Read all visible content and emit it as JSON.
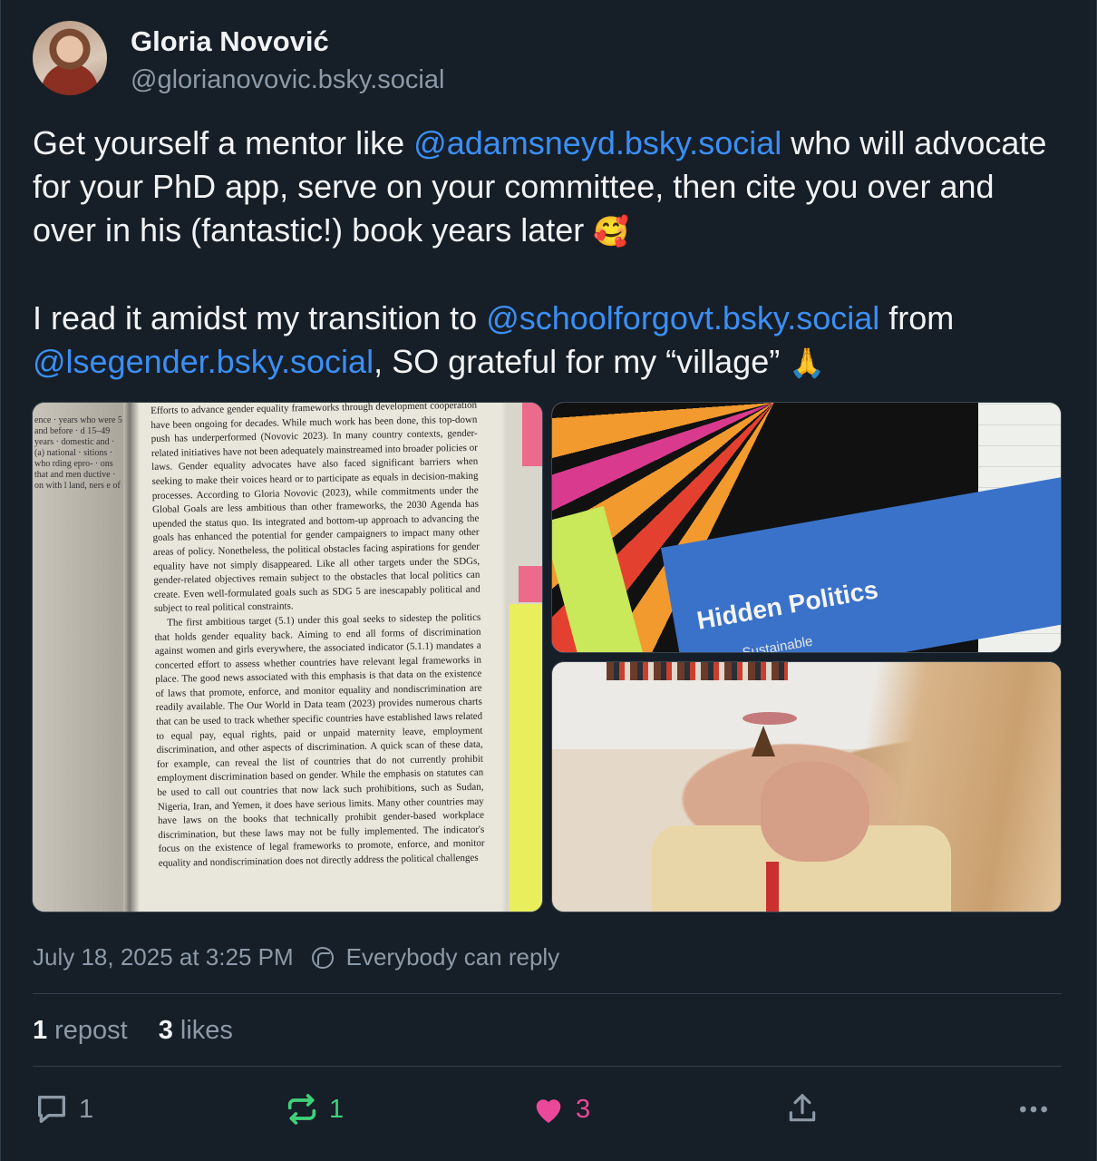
{
  "author": {
    "display_name": "Gloria Novović",
    "handle": "@glorianovovic.bsky.social"
  },
  "post": {
    "para1_a": "Get yourself a mentor like ",
    "mention1": "@adamsneyd.bsky.social",
    "para1_b": " who will advocate for your PhD app, serve on your committee, then cite you over and over in his (fantastic!) book years later ",
    "emoji1": "🥰",
    "para2_a": "I read it amidst my transition to ",
    "mention2": "@schoolforgovt.bsky.social",
    "para2_b": " from ",
    "mention3": "@lsegender.bsky.social",
    "para2_c": ", SO grateful for my “village” ",
    "emoji2": "🙏"
  },
  "media": {
    "book_page_para1": "Efforts to advance gender equality frameworks through development cooperation have been ongoing for decades. While much work has been done, this top-down push has underperformed (Novovic 2023). In many country contexts, gender-related initiatives have not been adequately mainstreamed into broader policies or laws. Gender equality advocates have also faced significant barriers when seeking to make their voices heard or to participate as equals in decision-making processes. According to Gloria Novovic (2023), while commitments under the Global Goals are less ambitious than other frameworks, the 2030 Agenda has upended the status quo. Its integrated and bottom-up approach to advancing the goals has enhanced the potential for gender campaigners to impact many other areas of policy. Nonetheless, the political obstacles facing aspirations for gender equality have not simply disappeared. Like all other targets under the SDGs, gender-related objectives remain subject to the obstacles that local politics can create. Even well-formulated goals such as SDG 5 are inescapably political and subject to real political constraints.",
    "book_page_para2": "The first ambitious target (5.1) under this goal seeks to sidestep the politics that holds gender equality back. Aiming to end all forms of discrimination against women and girls everywhere, the associated indicator (5.1.1) mandates a concerted effort to assess whether countries have relevant legal frameworks in place. The good news associated with this emphasis is that data on the existence of laws that promote, enforce, and monitor equality and nondiscrimination are readily available. The Our World in Data team (2023) provides numerous charts that can be used to track whether specific countries have established laws related to equal pay, equal rights, paid or unpaid maternity leave, employment discrimination, and other aspects of discrimination. A quick scan of these data, for example, can reveal the list of countries that do not currently prohibit employment discrimination based on gender. While the emphasis on statutes can be used to call out countries that now lack such prohibitions, such as Sudan, Nigeria, Iran, and Yemen, it does have serious limits. Many other countries may have laws on the books that technically prohibit gender-based workplace discrimination, but these laws may not be fully implemented. The indicator's focus on the existence of legal frameworks to promote, enforce, and monitor equality and nondiscrimination does not directly address the political challenges",
    "margin_text": "ence · years who were 5 and before · d 15–49 years · domestic and · (a) national · sitions · who rding epro- · ons that and men ductive · on with l land, ners e of",
    "book_title": "Hidden Politics",
    "book_subtitle": "Sustainable"
  },
  "timestamp": "July 18, 2025 at 3:25 PM",
  "reply_setting": "Everybody can reply",
  "stats": {
    "reposts_num": "1",
    "reposts_label": "repost",
    "likes_num": "3",
    "likes_label": "likes"
  },
  "actions": {
    "reply_count": "1",
    "repost_count": "1",
    "like_count": "3"
  },
  "colors": {
    "background": "#161e27",
    "mention": "#3b8ff5",
    "repost_active": "#3fd17a",
    "like_active": "#ec4899",
    "muted": "#8c9aa8"
  }
}
